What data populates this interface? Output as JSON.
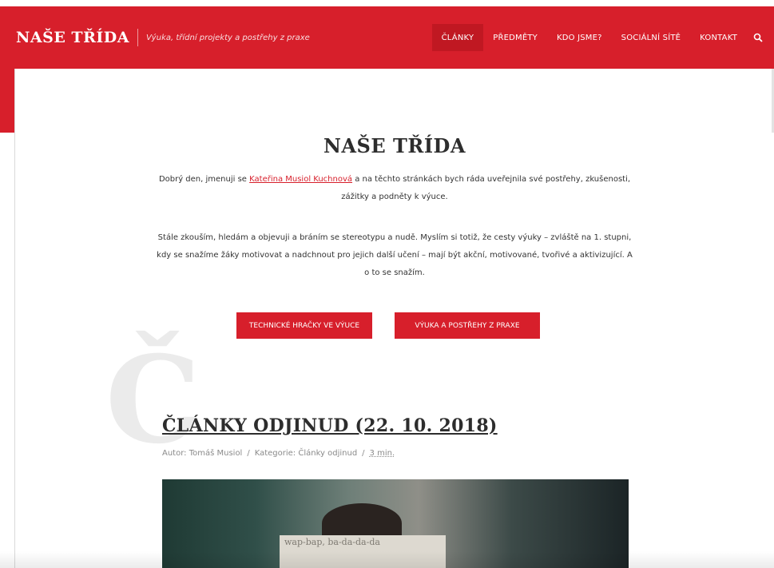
{
  "header": {
    "logo": "NAŠE TŘÍDA",
    "tagline": "Výuka, třídní projekty a postřehy z praxe",
    "nav": [
      {
        "label": "ČLÁNKY",
        "active": true
      },
      {
        "label": "PŘEDMĚTY",
        "active": false
      },
      {
        "label": "KDO JSME?",
        "active": false
      },
      {
        "label": "SOCIÁLNÍ SÍTĚ",
        "active": false
      },
      {
        "label": "KONTAKT",
        "active": false
      }
    ],
    "search_icon": "search-icon",
    "accent": "#d71f2b"
  },
  "intro": {
    "title": "NAŠE TŘÍDA",
    "p1_before": "Dobrý den, jmenuji se ",
    "p1_link": "Kateřina Musiol Kuchnová",
    "p1_after": " a na těchto stránkách bych ráda uveřejnila své postřehy, zkušenosti, zážitky a podněty k výuce.",
    "p2": "Stále zkouším, hledám a objevuji a bráním se stereotypu a nudě. Myslím si totiž, že cesty výuky – zvláště na 1. stupni, kdy se snažíme žáky motivovat a nadchnout pro jejich další učení – mají být akční, motivované, tvořivé a aktivizující. A o to se snažím.",
    "buttons": [
      "TECHNICKÉ HRAČKY VE VÝUCE",
      "VÝUKA A POSTŘEHY Z PRAXE"
    ]
  },
  "article": {
    "section_letter": "Č",
    "title": "ČLÁNKY ODJINUD (22. 10. 2018)",
    "author": "Autor: Tomáš Musiol",
    "category": "Kategorie: Články odjinud",
    "read_time": "3 min.",
    "image_text": "wap-bap, ba-da-da-da"
  }
}
